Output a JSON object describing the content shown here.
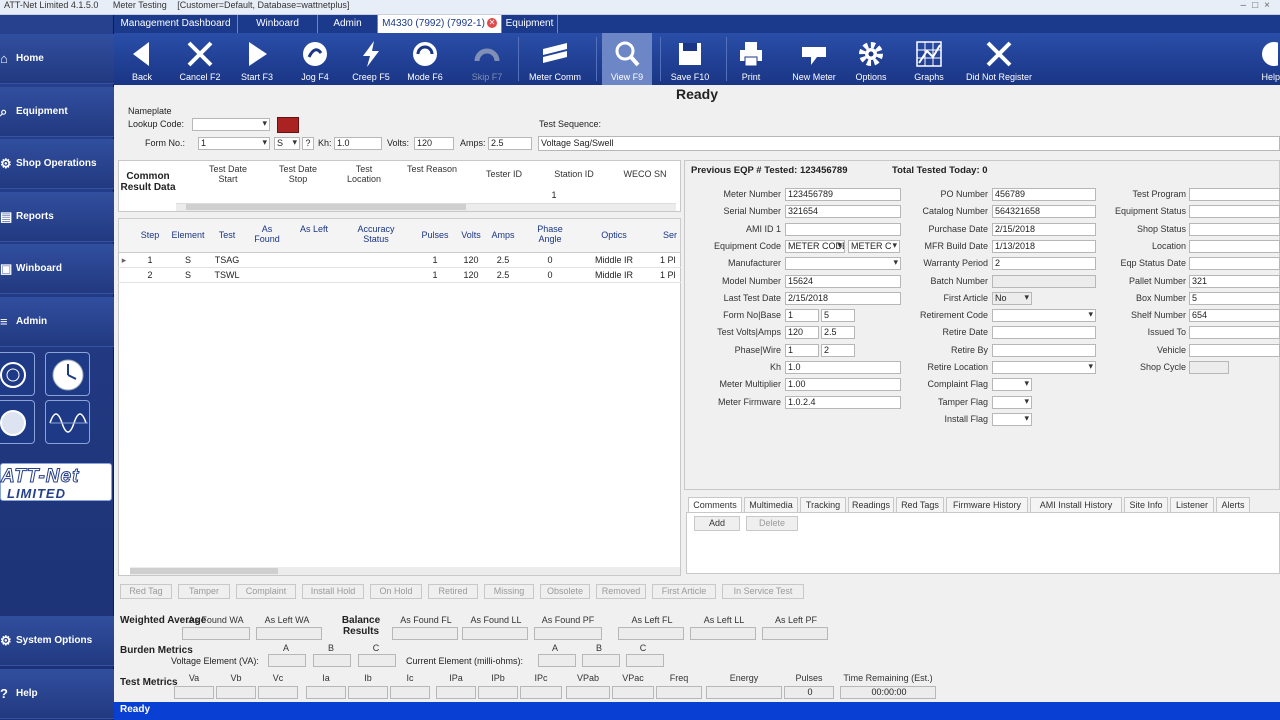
{
  "window": {
    "title": "ATT-Net Limited 4.1.5.0",
    "module": "Meter Testing",
    "context": "[Customer=Default, Database=wattnetplus]"
  },
  "sidebar": {
    "items": [
      {
        "label": "Home"
      },
      {
        "label": "Equipment"
      },
      {
        "label": "Shop Operations"
      },
      {
        "label": "Reports"
      },
      {
        "label": "Winboard"
      },
      {
        "label": "Admin"
      }
    ],
    "bottom": [
      {
        "label": "System Options"
      },
      {
        "label": "Help"
      }
    ],
    "logo_line1": "ATT-Net",
    "logo_line2": "LIMITED"
  },
  "tabs": [
    {
      "label": "Management Dashboard"
    },
    {
      "label": "Winboard"
    },
    {
      "label": "Admin"
    },
    {
      "label": "M4330 (7992) (7992-1)"
    },
    {
      "label": "Equipment"
    }
  ],
  "toolbar": [
    {
      "label": "Back",
      "icon": "back-arrow-icon"
    },
    {
      "label": "Cancel F2",
      "icon": "x-icon"
    },
    {
      "label": "Start F3",
      "icon": "play-icon"
    },
    {
      "label": "Jog F4",
      "icon": "jog-icon"
    },
    {
      "label": "Creep F5",
      "icon": "bolt-icon"
    },
    {
      "label": "Mode F6",
      "icon": "mode-icon"
    },
    {
      "label": "Skip F7",
      "icon": "skip-icon"
    },
    {
      "label": "Meter Comm",
      "icon": "meter-comm-icon"
    },
    {
      "label": "View F9",
      "icon": "magnifier-icon"
    },
    {
      "label": "Save F10",
      "icon": "save-icon"
    },
    {
      "label": "Print",
      "icon": "print-icon"
    },
    {
      "label": "New Meter",
      "icon": "new-meter-icon"
    },
    {
      "label": "Options",
      "icon": "gear-icon"
    },
    {
      "label": "Graphs",
      "icon": "graph-icon"
    },
    {
      "label": "Did Not Register",
      "icon": "x-icon"
    },
    {
      "label": "Help",
      "icon": "help-icon"
    }
  ],
  "status_title": "Ready",
  "nameplate": {
    "title": "Nameplate",
    "lookup_label": "Lookup Code:",
    "lookup_value": "",
    "form_label": "Form No.:",
    "form_value": "1",
    "s_value": "S",
    "q_value": "?",
    "kh_label": "Kh:",
    "kh_value": "1.0",
    "volts_label": "Volts:",
    "volts_value": "120",
    "amps_label": "Amps:",
    "amps_value": "2.5",
    "seq_label": "Test Sequence:",
    "seq_value": "Voltage Sag/Swell"
  },
  "common": {
    "title": "Common Result Data",
    "headers": [
      "Test Date Start",
      "Test Date Stop",
      "Test Location",
      "Test Reason",
      "Tester ID",
      "Station ID",
      "WECO SN"
    ],
    "station_value": "1"
  },
  "steps": {
    "headers": [
      "Step",
      "Element",
      "Test",
      "As Found",
      "As Left",
      "Accuracy Status",
      "Pulses",
      "Volts",
      "Amps",
      "Phase Angle",
      "Optics",
      "Ser"
    ],
    "rows": [
      [
        "1",
        "S",
        "TSAG",
        "",
        "",
        "",
        "1",
        "120",
        "2.5",
        "0",
        "Middle IR",
        "1 Pl"
      ],
      [
        "2",
        "S",
        "TSWL",
        "",
        "",
        "",
        "1",
        "120",
        "2.5",
        "0",
        "Middle IR",
        "1 Pl"
      ]
    ]
  },
  "info": {
    "prev_label": "Previous EQP # Tested:",
    "prev_value": "123456789",
    "total_label": "Total Tested Today:",
    "total_value": "0",
    "col1": [
      {
        "label": "Meter Number",
        "value": "123456789"
      },
      {
        "label": "Serial Number",
        "value": "321654"
      },
      {
        "label": "AMI ID 1",
        "value": ""
      },
      {
        "label": "Equipment Code",
        "value": "METER CODE",
        "value2": "METER C"
      },
      {
        "label": "Manufacturer",
        "value": ""
      },
      {
        "label": "Model Number",
        "value": "15624"
      },
      {
        "label": "Last Test Date",
        "value": "2/15/2018"
      },
      {
        "label": "Form No|Base",
        "value": "1",
        "value2": "5"
      },
      {
        "label": "Test Volts|Amps",
        "value": "120",
        "value2": "2.5"
      },
      {
        "label": "Phase|Wire",
        "value": "1",
        "value2": "2"
      },
      {
        "label": "Kh",
        "value": "1.0"
      },
      {
        "label": "Meter Multiplier",
        "value": "1.00"
      },
      {
        "label": "Meter Firmware",
        "value": "1.0.2.4"
      }
    ],
    "col2": [
      {
        "label": "PO Number",
        "value": "456789"
      },
      {
        "label": "Catalog Number",
        "value": "564321658"
      },
      {
        "label": "Purchase Date",
        "value": "2/15/2018"
      },
      {
        "label": "MFR Build Date",
        "value": "1/13/2018"
      },
      {
        "label": "Warranty Period",
        "value": "2"
      },
      {
        "label": "Batch Number",
        "value": ""
      },
      {
        "label": "First Article",
        "value": "No"
      },
      {
        "label": "Retirement Code",
        "value": ""
      },
      {
        "label": "Retire Date",
        "value": ""
      },
      {
        "label": "Retire By",
        "value": ""
      },
      {
        "label": "Retire Location",
        "value": ""
      },
      {
        "label": "Complaint Flag",
        "value": ""
      },
      {
        "label": "Tamper Flag",
        "value": ""
      },
      {
        "label": "Install Flag",
        "value": ""
      }
    ],
    "col3": [
      {
        "label": "Test Program",
        "value": ""
      },
      {
        "label": "Equipment Status",
        "value": ""
      },
      {
        "label": "Shop Status",
        "value": ""
      },
      {
        "label": "Location",
        "value": ""
      },
      {
        "label": "Eqp Status Date",
        "value": ""
      },
      {
        "label": "Pallet Number",
        "value": "321"
      },
      {
        "label": "Box Number",
        "value": "5"
      },
      {
        "label": "Shelf Number",
        "value": "654"
      },
      {
        "label": "Issued To",
        "value": ""
      },
      {
        "label": "Vehicle",
        "value": ""
      },
      {
        "label": "Shop Cycle",
        "value": ""
      }
    ]
  },
  "bottom_tabs": [
    "Comments",
    "Multimedia",
    "Tracking",
    "Readings",
    "Red Tags",
    "Firmware History",
    "AMI Install History",
    "Site Info",
    "Listener",
    "Alerts"
  ],
  "comments": {
    "add_label": "Add",
    "delete_label": "Delete"
  },
  "flag_buttons": [
    "Red Tag",
    "Tamper",
    "Complaint",
    "Install Hold",
    "On Hold",
    "Retired",
    "Missing",
    "Obsolete",
    "Removed",
    "First Article",
    "In Service Test"
  ],
  "weighted": {
    "title": "Weighted Average",
    "cols": [
      "As Found WA",
      "As Left WA"
    ],
    "balance_title": "Balance Results",
    "balance_cols": [
      "As Found FL",
      "As Found LL",
      "As Found PF",
      "As Left FL",
      "As Left LL",
      "As Left PF"
    ]
  },
  "burden": {
    "title": "Burden Metrics",
    "voltage_label": "Voltage Element (VA):",
    "current_label": "Current Element (milli-ohms):",
    "abc": [
      "A",
      "B",
      "C"
    ]
  },
  "test_metrics": {
    "title": "Test Metrics",
    "cols": [
      "Va",
      "Vb",
      "Vc",
      "Ia",
      "Ib",
      "Ic",
      "IPa",
      "IPb",
      "IPc",
      "VPab",
      "VPac",
      "Freq",
      "Energy",
      "Pulses",
      "Time Remaining (Est.)"
    ],
    "pulses_value": "0",
    "time_value": "00:00:00"
  },
  "statusbar": {
    "text": "Ready"
  }
}
